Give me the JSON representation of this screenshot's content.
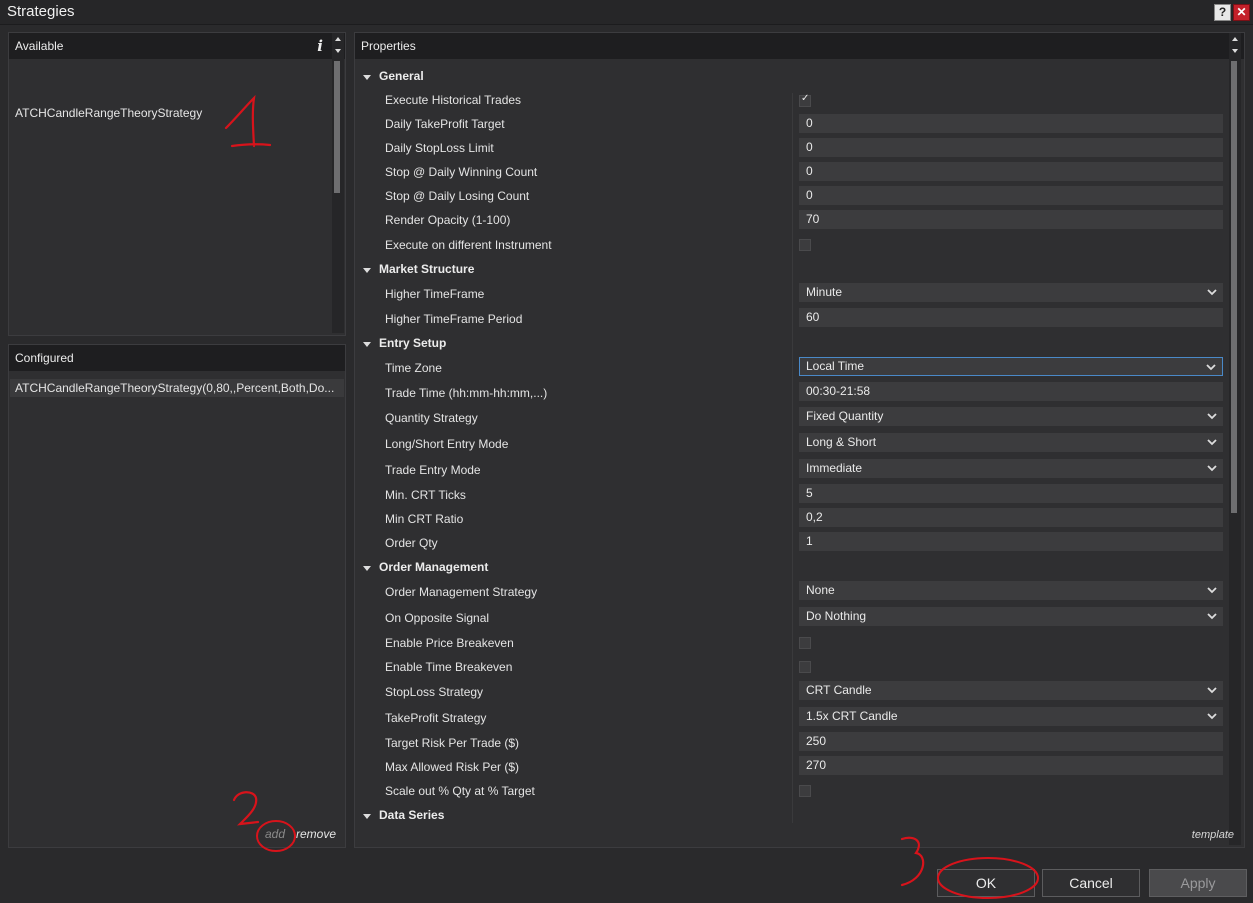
{
  "window": {
    "title": "Strategies",
    "help_label": "?",
    "close_label": "✕"
  },
  "available": {
    "header": "Available",
    "info_label": "i",
    "items": [
      "ATCHCandleRangeTheoryStrategy"
    ]
  },
  "configured": {
    "header": "Configured",
    "items": [
      "ATCHCandleRangeTheoryStrategy(0,80,,Percent,Both,Do..."
    ],
    "add_label": "add",
    "remove_label": "remove"
  },
  "properties": {
    "header": "Properties",
    "template_label": "template",
    "sections": {
      "general": "General",
      "market_structure": "Market Structure",
      "entry_setup": "Entry Setup",
      "order_management": "Order Management",
      "data_series": "Data Series"
    },
    "rows": [
      {
        "label": "Execute Historical Trades",
        "checked": true
      },
      {
        "label": "Daily TakeProfit Target",
        "value": "0"
      },
      {
        "label": "Daily StopLoss Limit",
        "value": "0"
      },
      {
        "label": "Stop @ Daily Winning Count",
        "value": "0"
      },
      {
        "label": "Stop @ Daily Losing Count",
        "value": "0"
      },
      {
        "label": "Render Opacity (1-100)",
        "value": "70"
      },
      {
        "label": "Execute on different Instrument",
        "checked": false
      },
      {
        "label": "Higher TimeFrame",
        "value": "Minute"
      },
      {
        "label": "Higher TimeFrame Period",
        "value": "60"
      },
      {
        "label": "Time Zone",
        "value": "Local Time"
      },
      {
        "label": "Trade Time (hh:mm-hh:mm,...)",
        "value": "00:30-21:58"
      },
      {
        "label": "Quantity Strategy",
        "value": "Fixed Quantity"
      },
      {
        "label": "Long/Short Entry Mode",
        "value": "Long & Short"
      },
      {
        "label": "Trade Entry Mode",
        "value": "Immediate"
      },
      {
        "label": "Min. CRT Ticks",
        "value": "5"
      },
      {
        "label": "Min CRT Ratio",
        "value": "0,2"
      },
      {
        "label": "Order Qty",
        "value": "1"
      },
      {
        "label": "Order Management Strategy",
        "value": "None"
      },
      {
        "label": "On Opposite Signal",
        "value": "Do Nothing"
      },
      {
        "label": "Enable Price Breakeven",
        "checked": false
      },
      {
        "label": "Enable Time Breakeven",
        "checked": false
      },
      {
        "label": "StopLoss Strategy",
        "value": "CRT Candle"
      },
      {
        "label": "TakeProfit Strategy",
        "value": "1.5x CRT Candle"
      },
      {
        "label": "Target Risk Per Trade ($)",
        "value": "250"
      },
      {
        "label": "Max Allowed Risk Per ($)",
        "value": "270"
      },
      {
        "label": "Scale out % Qty at % Target",
        "checked": false
      }
    ]
  },
  "footer": {
    "ok_label": "OK",
    "cancel_label": "Cancel",
    "apply_label": "Apply"
  },
  "annotations": {
    "one": "1",
    "two": "2",
    "three": "3"
  },
  "colors": {
    "annotation_red": "#d8131b",
    "focus_blue": "#4a89c8",
    "close_red": "#c4202a"
  }
}
